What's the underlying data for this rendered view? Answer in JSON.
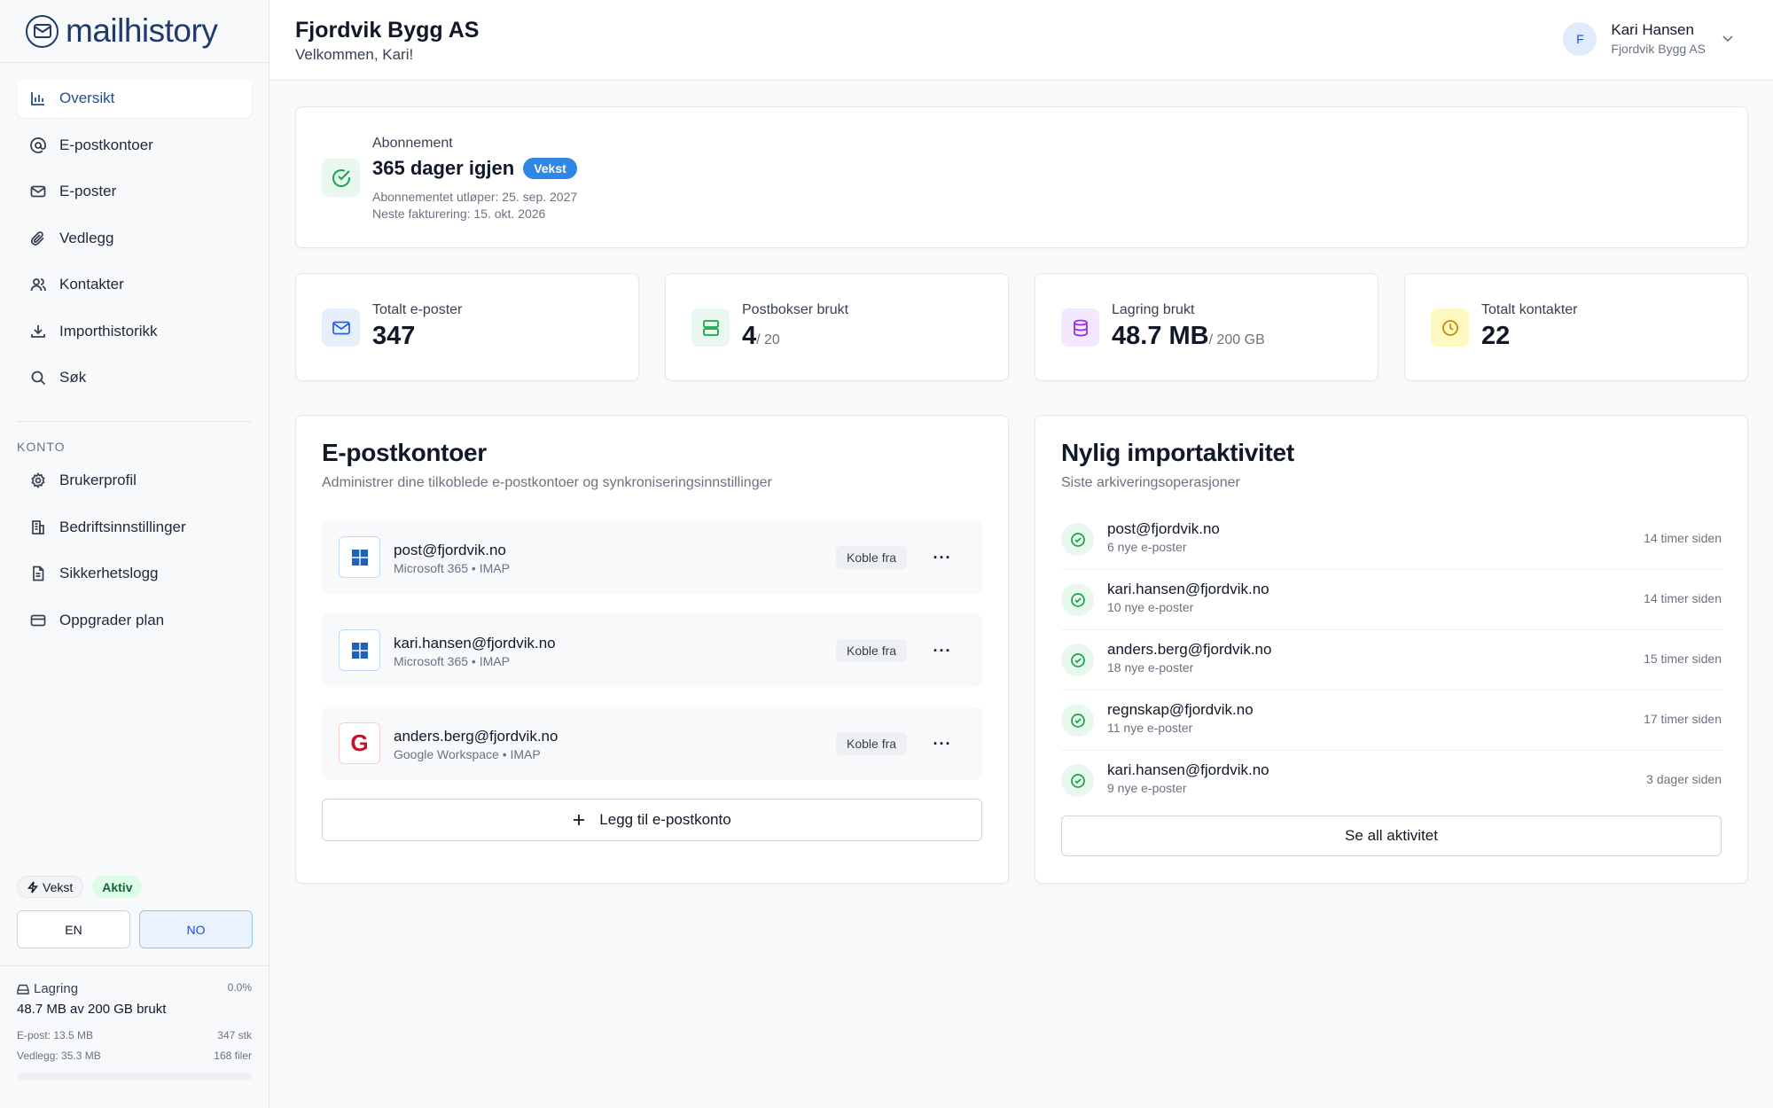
{
  "brand": {
    "name": "mailhistory"
  },
  "sidebar": {
    "items": [
      {
        "label": "Oversikt",
        "icon": "bar-chart-icon"
      },
      {
        "label": "E-postkontoer",
        "icon": "at-sign-icon"
      },
      {
        "label": "E-poster",
        "icon": "mail-icon"
      },
      {
        "label": "Vedlegg",
        "icon": "paperclip-icon"
      },
      {
        "label": "Kontakter",
        "icon": "users-icon"
      },
      {
        "label": "Importhistorikk",
        "icon": "download-icon"
      },
      {
        "label": "Søk",
        "icon": "search-icon"
      }
    ],
    "account_heading": "KONTO",
    "account_items": [
      {
        "label": "Brukerprofil",
        "icon": "gear-icon"
      },
      {
        "label": "Bedriftsinnstillinger",
        "icon": "building-icon"
      },
      {
        "label": "Sikkerhetslogg",
        "icon": "file-text-icon"
      },
      {
        "label": "Oppgrader plan",
        "icon": "credit-card-icon"
      }
    ],
    "plan_label": "Vekst",
    "status_label": "Aktiv",
    "languages": [
      "EN",
      "NO"
    ],
    "active_language": "NO"
  },
  "storage": {
    "label": "Lagring",
    "percent": "0.0%",
    "used_text": "48.7 MB av 200 GB brukt",
    "email_line": "E-post: 13.5 MB",
    "email_count": "347 stk",
    "attach_line": "Vedlegg: 35.3 MB",
    "attach_count": "168 filer",
    "fill_fraction": 0.0
  },
  "header": {
    "title": "Fjordvik Bygg AS",
    "subtitle": "Velkommen, Kari!",
    "user_initial": "F",
    "user_name": "Kari Hansen",
    "user_company": "Fjordvik Bygg AS"
  },
  "subscription": {
    "label": "Abonnement",
    "days": "365 dager igjen",
    "badge": "Vekst",
    "expires": "Abonnementet utløper: 25. sep. 2027",
    "next_billing": "Neste fakturering: 15. okt. 2026"
  },
  "stats": [
    {
      "label": "Totalt e-poster",
      "value": "347",
      "unit": "",
      "icon": "mail-icon",
      "color": "#e7effd",
      "stroke": "#2563eb"
    },
    {
      "label": "Postbokser brukt",
      "value": "4",
      "unit": "/ 20",
      "icon": "server-icon",
      "color": "#e8f8ee",
      "stroke": "#16a34a"
    },
    {
      "label": "Lagring brukt",
      "value": "48.7 MB",
      "unit": "/ 200 GB",
      "icon": "database-icon",
      "color": "#f3e8fd",
      "stroke": "#9333ea"
    },
    {
      "label": "Totalt kontakter",
      "value": "22",
      "unit": "",
      "icon": "clock-icon",
      "color": "#fef9c3",
      "stroke": "#ca8a04"
    }
  ],
  "accounts_section": {
    "title": "E-postkontoer",
    "subtitle": "Administrer dine tilkoblede e-postkontoer og synkroniseringsinnstillinger",
    "disconnect_label": "Koble fra",
    "add_label": "Legg til e-postkonto",
    "accounts": [
      {
        "email": "post@fjordvik.no",
        "type": "Microsoft 365 • IMAP",
        "provider": "microsoft"
      },
      {
        "email": "kari.hansen@fjordvik.no",
        "type": "Microsoft 365 • IMAP",
        "provider": "microsoft"
      },
      {
        "email": "anders.berg@fjordvik.no",
        "type": "Google Workspace • IMAP",
        "provider": "google",
        "letter": "G"
      }
    ]
  },
  "activity_section": {
    "title": "Nylig importaktivitet",
    "subtitle": "Siste arkiveringsoperasjoner",
    "see_all_label": "Se all aktivitet",
    "items": [
      {
        "email": "post@fjordvik.no",
        "count": "6 nye e-poster",
        "time": "14 timer siden"
      },
      {
        "email": "kari.hansen@fjordvik.no",
        "count": "10 nye e-poster",
        "time": "14 timer siden"
      },
      {
        "email": "anders.berg@fjordvik.no",
        "count": "18 nye e-poster",
        "time": "15 timer siden"
      },
      {
        "email": "regnskap@fjordvik.no",
        "count": "11 nye e-poster",
        "time": "17 timer siden"
      },
      {
        "email": "kari.hansen@fjordvik.no",
        "count": "9 nye e-poster",
        "time": "3 dager siden"
      }
    ]
  },
  "colors": {
    "accent": "#1f4e8c",
    "badge_blue": "#2f86e6",
    "success": "#16a34a"
  }
}
